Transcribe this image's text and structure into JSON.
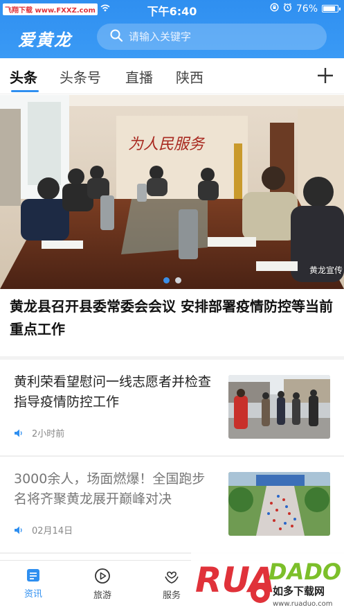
{
  "status_bar": {
    "carrier_tag": "飞翔下载 www.FXXZ.com",
    "time": "下午6:40",
    "battery_percent": "76%",
    "icons": [
      "wifi-icon",
      "rotation-lock-icon",
      "alarm-icon",
      "battery-icon"
    ]
  },
  "header": {
    "app_title": "爱黄龙",
    "search_placeholder": "请输入关键字"
  },
  "tabs": {
    "items": [
      {
        "label": "头条",
        "active": true
      },
      {
        "label": "头条号",
        "active": false
      },
      {
        "label": "直播",
        "active": false
      },
      {
        "label": "陕西",
        "active": false
      }
    ],
    "add_icon": "plus-icon"
  },
  "hero": {
    "banner_text": "为人民服务",
    "source_label": "黄龙宣传",
    "slide_count": 2,
    "active_slide": 1,
    "headline": "黄龙县召开县委常委会会议 安排部署疫情防控等当前重点工作"
  },
  "news": [
    {
      "title": "黄利荣看望慰问一线志愿者并检查指导疫情防控工作",
      "time": "2小时前",
      "read": false
    },
    {
      "title": "3000余人，场面燃爆！全国跑步名将齐聚黄龙展开巅峰对决",
      "time": "02月14日",
      "read": true
    }
  ],
  "bottom_nav": {
    "items": [
      {
        "label": "资讯",
        "icon": "news-icon",
        "active": true
      },
      {
        "label": "旅游",
        "icon": "play-circle-icon",
        "active": false
      },
      {
        "label": "服务",
        "icon": "heart-hands-icon",
        "active": false
      }
    ]
  },
  "watermark": {
    "brand": "RUANDAO",
    "caption": "如多下载网",
    "url": "www.ruaduo.com"
  },
  "colors": {
    "accent": "#2f8ff0",
    "watermark_red": "#e0323a",
    "watermark_green": "#7cbf2a"
  }
}
